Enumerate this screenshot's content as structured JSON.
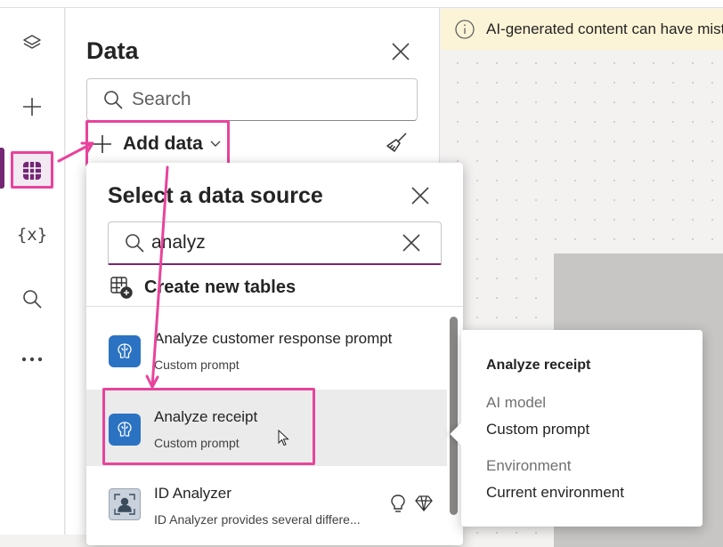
{
  "banner": {
    "text": "AI-generated content can have mistakes."
  },
  "rail": {
    "items": [
      "layers-icon",
      "plus-icon",
      "table-grid-icon",
      "variables-icon",
      "search-icon",
      "more-icon"
    ]
  },
  "data_panel": {
    "title": "Data",
    "search_placeholder": "Search",
    "add_data_label": "Add data"
  },
  "source_panel": {
    "title": "Select a data source",
    "search_value": "analyz",
    "create_tables_label": "Create new tables",
    "items": [
      {
        "title": "Analyze customer response prompt",
        "subtitle": "Custom prompt"
      },
      {
        "title": "Analyze receipt",
        "subtitle": "Custom prompt"
      },
      {
        "title": "ID Analyzer",
        "subtitle": "ID Analyzer provides several differe..."
      }
    ]
  },
  "detail_card": {
    "title": "Analyze receipt",
    "type_label": "AI model",
    "type_value": "Custom prompt",
    "env_label": "Environment",
    "env_value": "Current environment"
  },
  "colors": {
    "accent": "#742774",
    "highlight": "#e8439c",
    "ai_icon": "#2b73c2"
  }
}
